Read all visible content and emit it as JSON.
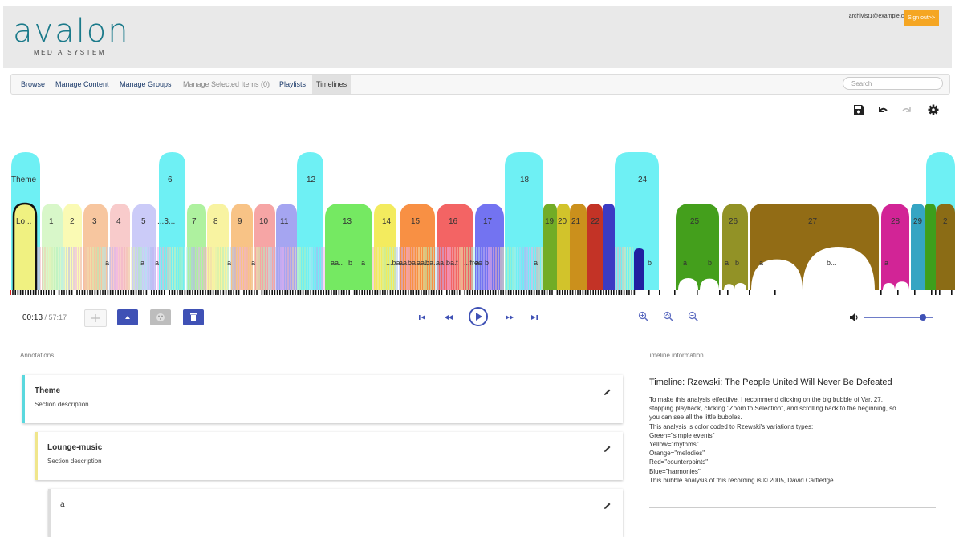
{
  "header": {
    "logo_main": "avalon",
    "logo_sub": "MEDIA SYSTEM",
    "user_email": "archivist1@example.com",
    "sign_out": "Sign out>>"
  },
  "nav": {
    "items": [
      "Browse",
      "Manage Content",
      "Manage Groups",
      "Manage Selected Items (0)",
      "Playlists",
      "Timelines"
    ],
    "search_placeholder": "Search"
  },
  "toolbar": {
    "icons": [
      "save-icon",
      "undo-icon",
      "redo-icon",
      "gear-icon"
    ]
  },
  "timeline": {
    "top_labels": [
      "Theme",
      "6",
      "12",
      "18",
      "24"
    ],
    "mid_labels": [
      "Lo...",
      "1",
      "2",
      "3",
      "4",
      "5",
      "...3...",
      "7",
      "8",
      "9",
      "10",
      "11",
      "13",
      "14",
      "15",
      "16",
      "17",
      "19",
      "20",
      "21",
      "22",
      "25",
      "26",
      "27",
      "28",
      "29",
      "2"
    ],
    "small_labels": [
      "a",
      "a",
      "a",
      "a",
      "a",
      "aa..",
      "b",
      "a",
      "...ba..",
      "aa..",
      "ba..",
      "aa..",
      "ba..",
      "aa..",
      "ba..",
      "f",
      "...free",
      "a",
      "b",
      "a",
      "b",
      "a",
      "b",
      "a",
      "b",
      "a",
      "b...",
      "a"
    ]
  },
  "playback": {
    "current_time": "00:13",
    "separator": " / ",
    "total_time": "57:17",
    "volume": 0.85
  },
  "annotations": {
    "title": "Annotations",
    "items": [
      {
        "title": "Theme",
        "desc": "Section description",
        "color": "#5ad8de"
      },
      {
        "title": "Lounge-music",
        "desc": "Section description",
        "color": "#f0e68c"
      },
      {
        "title": "a",
        "desc": "",
        "color": "#dddddd"
      }
    ]
  },
  "info": {
    "panel_title": "Timeline information",
    "title": "Timeline: Rzewski: The People United Will Never Be Defeated",
    "lines": [
      "To make this analysis effectiive, I recommend clicking on the big bubble of Var. 27,",
      "stopping playback, clicking \"Zoom to Selection\", and scrolling back to the beginning, so",
      "you can see all the little bubbles.",
      "This analysis is color coded to Rzewski's variations types:",
      "Green=\"simple events\"",
      "Yellow=\"rhythms\"",
      "Orange=\"melodies\"",
      "Red=\"counterpoints\"",
      "Blue=\"harmonies\"",
      "This bubble analysis of this recording is © 2005, David Cartledge"
    ]
  },
  "colors": {
    "accent": "#3f51b5",
    "header_bg": "#e9e9e9",
    "signout": "#f5a623"
  }
}
